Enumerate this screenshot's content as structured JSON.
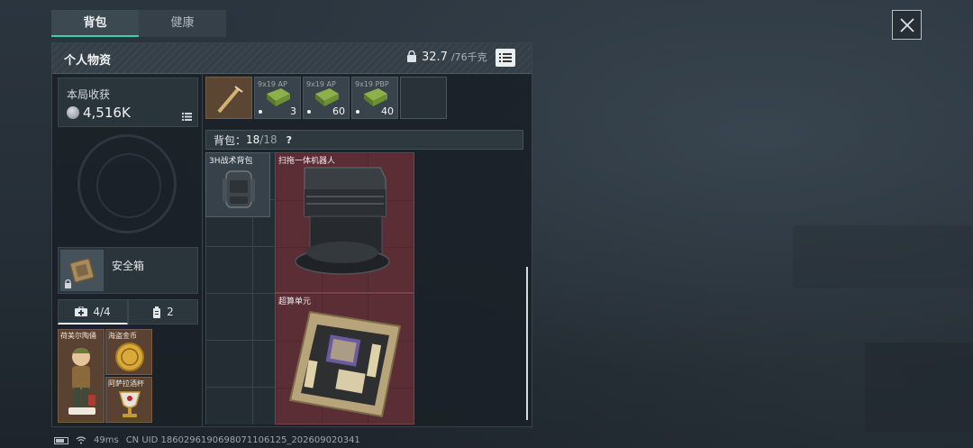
{
  "tabs": [
    {
      "label": "背包"
    },
    {
      "label": "健康"
    }
  ],
  "panel": {
    "title": "个人物资",
    "weight_current": "32.7",
    "weight_max": "/76千克"
  },
  "income": {
    "label": "本局收获",
    "value": "4,516K"
  },
  "safe_box": {
    "label": "安全箱"
  },
  "counts": {
    "left": "4/4",
    "right": "2"
  },
  "valuables": [
    {
      "name": "荷美尔陶俑"
    },
    {
      "name": "海盗金币"
    },
    {
      "name": "阿萨拉酒杯"
    }
  ],
  "top_row": [
    {
      "label": "",
      "qty": ""
    },
    {
      "label": "9x19 AP",
      "qty": "3"
    },
    {
      "label": "9x19 AP",
      "qty": "60"
    },
    {
      "label": "9x19 PBP",
      "qty": "40"
    },
    {
      "label": "",
      "qty": ""
    }
  ],
  "backpack": {
    "label": "背包：",
    "used": "18",
    "total": "/18",
    "help": "?"
  },
  "items": [
    {
      "name": "3H战术背包"
    },
    {
      "name": "扫拖一体机器人"
    },
    {
      "name": "超算单元"
    }
  ],
  "status": {
    "ping": "49ms",
    "uid": "CN UID 1860296190698071106125_202609020341"
  },
  "colors": {
    "accent": "#39d0a8",
    "rare_item": "#5a2e34",
    "valuable_item": "#5a4232"
  }
}
